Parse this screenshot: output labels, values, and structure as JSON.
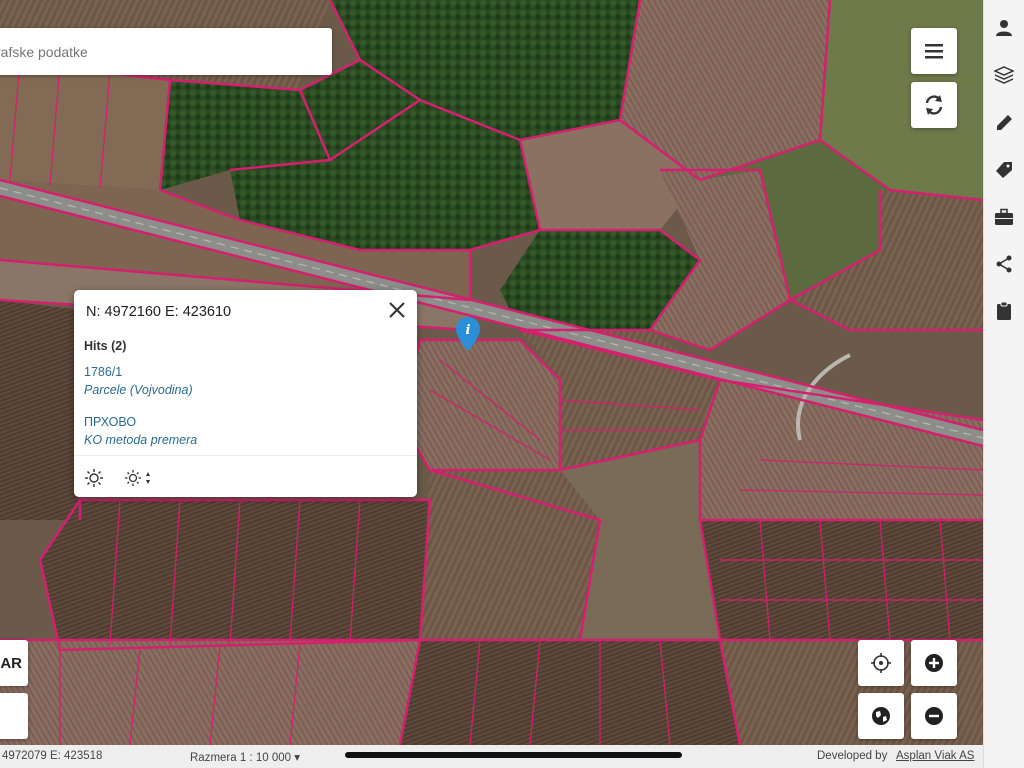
{
  "search": {
    "placeholder": "rafske podatke"
  },
  "map_controls": {
    "menu_icon": "hamburger-icon",
    "refresh_icon": "refresh-icon",
    "locate_icon": "crosshair-icon",
    "zoom_in_icon": "plus-icon",
    "zoom_out_icon": "minus-icon",
    "basemap_icon": "globe-icon"
  },
  "left_buttons": {
    "ar_label": "AR"
  },
  "popup": {
    "coordinates": "N: 4972160 E: 423610",
    "hits_label": "Hits (2)",
    "hits": [
      {
        "id": "1786/1",
        "layer": "Parcele (Vojvodina)"
      },
      {
        "id": "ПРХОВО",
        "layer": "KO metoda premera"
      }
    ]
  },
  "right_panel": {
    "items": [
      "user-icon",
      "layers-icon",
      "pencil-icon",
      "tag-icon",
      "briefcase-icon",
      "share-icon",
      "clipboard-icon"
    ]
  },
  "status_bar": {
    "coordinates": "4972079 E: 423518",
    "scale": "Razmera 1 : 10 000 ▾",
    "developed_by": "Developed by",
    "company": "Asplan Viak AS"
  },
  "colors": {
    "parcel_border": "#d4206e",
    "accent": "#2a8fd6",
    "link": "#2a6a93"
  }
}
